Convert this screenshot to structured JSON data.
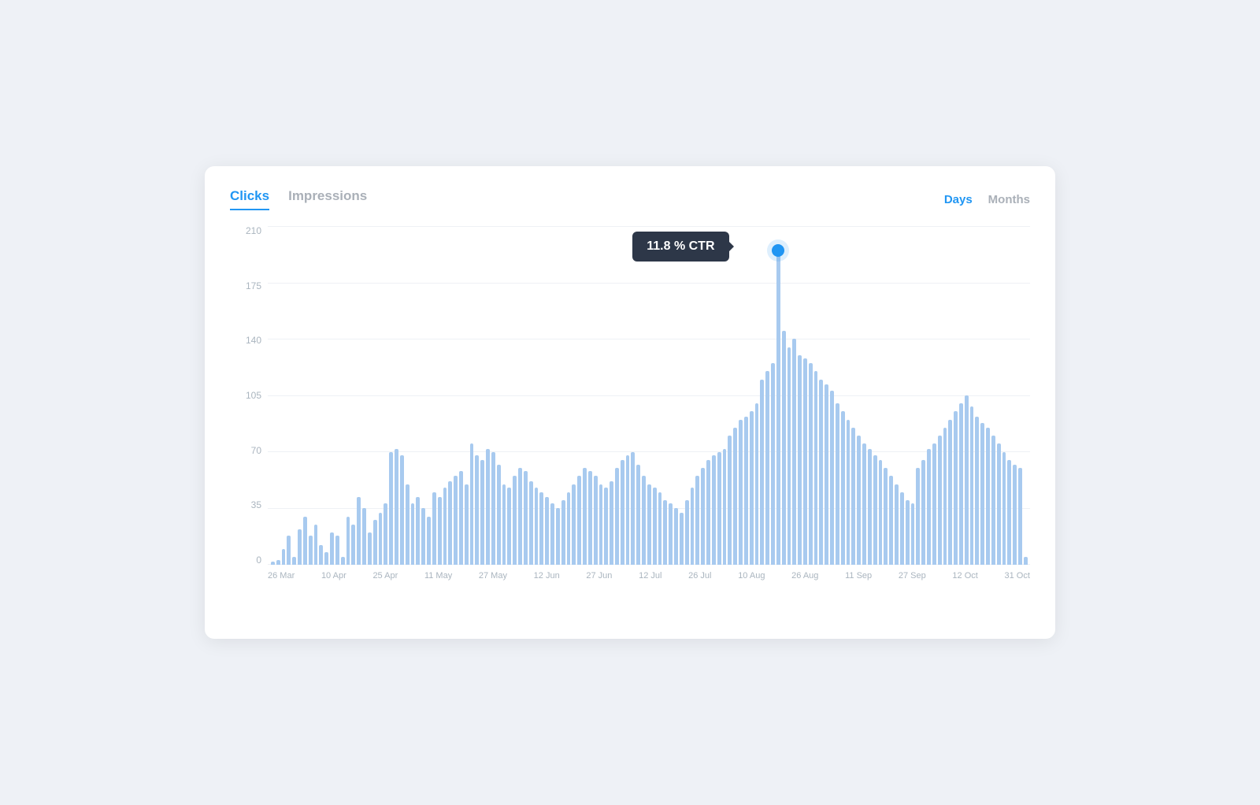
{
  "tabs_left": [
    {
      "label": "Clicks",
      "active": true
    },
    {
      "label": "Impressions",
      "active": false
    }
  ],
  "tabs_right": [
    {
      "label": "Days",
      "active": true
    },
    {
      "label": "Months",
      "active": false
    }
  ],
  "tooltip": {
    "value": "11.8 % CTR"
  },
  "y_labels": [
    "210",
    "175",
    "140",
    "105",
    "70",
    "35",
    "0"
  ],
  "x_labels": [
    "26 Mar",
    "10 Apr",
    "25 Apr",
    "11 May",
    "27 May",
    "12 Jun",
    "27 Jun",
    "12 Jul",
    "26 Jul",
    "10 Aug",
    "26 Aug",
    "11 Sep",
    "27 Sep",
    "12 Oct",
    "31 Oct"
  ],
  "bars": [
    2,
    3,
    10,
    18,
    5,
    22,
    30,
    18,
    25,
    12,
    8,
    20,
    18,
    5,
    30,
    25,
    42,
    35,
    20,
    28,
    32,
    38,
    70,
    72,
    68,
    50,
    38,
    42,
    35,
    30,
    45,
    42,
    48,
    52,
    55,
    58,
    50,
    75,
    68,
    65,
    72,
    70,
    62,
    50,
    48,
    55,
    60,
    58,
    52,
    48,
    45,
    42,
    38,
    35,
    40,
    45,
    50,
    55,
    60,
    58,
    55,
    50,
    48,
    52,
    60,
    65,
    68,
    70,
    62,
    55,
    50,
    48,
    45,
    40,
    38,
    35,
    32,
    40,
    48,
    55,
    60,
    65,
    68,
    70,
    72,
    80,
    85,
    90,
    92,
    95,
    100,
    115,
    120,
    125,
    195,
    145,
    135,
    140,
    130,
    128,
    125,
    120,
    115,
    112,
    108,
    100,
    95,
    90,
    85,
    80,
    75,
    72,
    68,
    65,
    60,
    55,
    50,
    45,
    40,
    38,
    60,
    65,
    72,
    75,
    80,
    85,
    90,
    95,
    100,
    105,
    98,
    92,
    88,
    85,
    80,
    75,
    70,
    65,
    62,
    60,
    5
  ]
}
